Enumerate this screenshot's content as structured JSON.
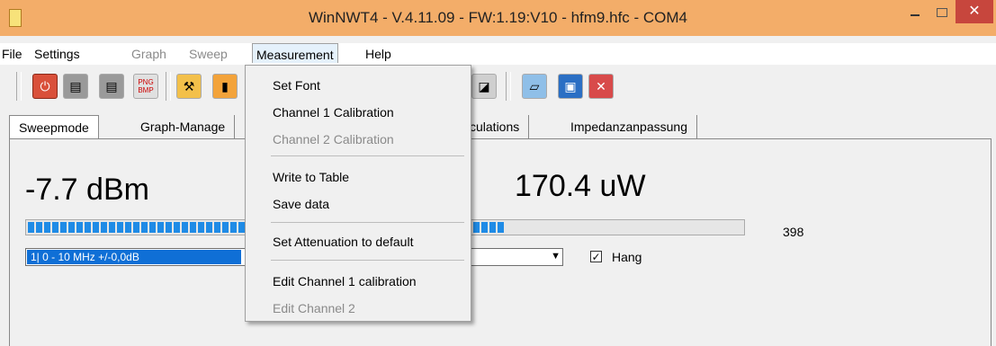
{
  "window": {
    "title": "WinNWT4 - V.4.11.09 - FW:1.19:V10 - hfm9.hfc - COM4",
    "close_glyph": "✕",
    "accent": "#f3ad69"
  },
  "menubar": {
    "items": [
      {
        "label": "File",
        "enabled": true
      },
      {
        "label": "Settings",
        "enabled": true
      },
      {
        "label": "Graph",
        "enabled": false
      },
      {
        "label": "Sweep",
        "enabled": false
      },
      {
        "label": "Measurement",
        "enabled": true,
        "open": true
      },
      {
        "label": "Help",
        "enabled": true
      }
    ]
  },
  "toolbar": {
    "icons": [
      "power-icon",
      "printer-icon",
      "printer-icon",
      "png-bmp-icon",
      "tool-icon",
      "probe-icon",
      "sweep-icon",
      "open-folder-icon",
      "save-icon",
      "stop-icon"
    ],
    "png_label": "PNG\nBMP"
  },
  "tabs": [
    "Sweepmode",
    "Graph-Manage",
    "culations",
    "Impedanzanpassung"
  ],
  "meter": {
    "dbm_text": "-7.7 dBm",
    "power_text": "170.4 uW",
    "bar_level": 0.66,
    "bar_value": "398",
    "bar_color": "#1f8be6",
    "calibration_selected": "1| 0 - 10 MHz +/-0,0dB",
    "hang_label": "Hang",
    "hang_checked": true
  },
  "measurement_menu": {
    "items": [
      {
        "label": "Set Font",
        "enabled": true
      },
      {
        "label": "Channel 1 Calibration",
        "enabled": true
      },
      {
        "label": "Channel 2 Calibration",
        "enabled": false
      },
      {
        "label": "Write to Table",
        "enabled": true
      },
      {
        "label": "Save data",
        "enabled": true
      },
      {
        "label": "Set Attenuation to default",
        "enabled": true
      },
      {
        "label": "Edit Channel 1 calibration",
        "enabled": true
      },
      {
        "label": "Edit Channel 2",
        "enabled": false
      }
    ]
  }
}
